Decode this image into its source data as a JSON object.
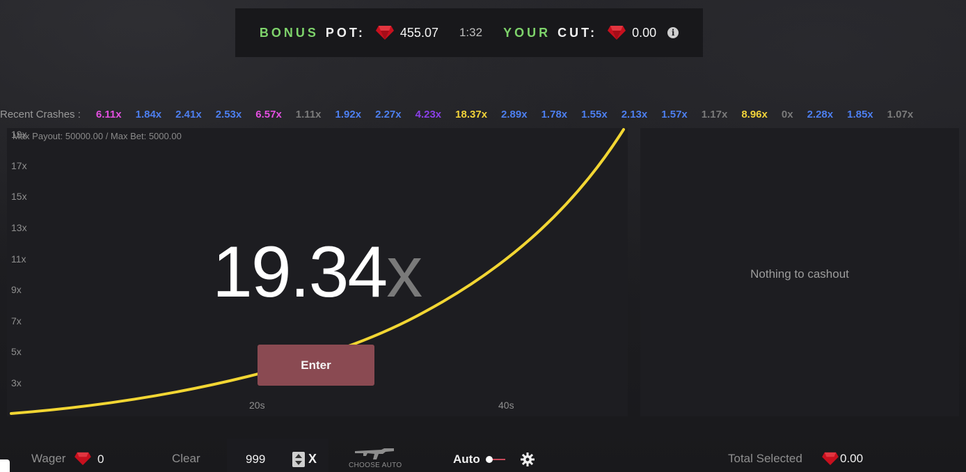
{
  "header": {
    "bonus_word": "BONUS",
    "pot_word": "POT:",
    "pot_value": "455.07",
    "timer": "1:32",
    "your_word": "YOUR",
    "cut_word": "CUT:",
    "cut_value": "0.00",
    "info_icon": "i"
  },
  "recent": {
    "label": "Recent Crashes :",
    "items": [
      {
        "text": "6.11x",
        "color": "#e34fe0"
      },
      {
        "text": "1.84x",
        "color": "#4d7ff0"
      },
      {
        "text": "2.41x",
        "color": "#4d7ff0"
      },
      {
        "text": "2.53x",
        "color": "#4d7ff0"
      },
      {
        "text": "6.57x",
        "color": "#e34fe0"
      },
      {
        "text": "1.11x",
        "color": "#7a7a7a"
      },
      {
        "text": "1.92x",
        "color": "#4d7ff0"
      },
      {
        "text": "2.27x",
        "color": "#4d7ff0"
      },
      {
        "text": "4.23x",
        "color": "#8a3fe8"
      },
      {
        "text": "18.37x",
        "color": "#f2d33a"
      },
      {
        "text": "2.89x",
        "color": "#4d7ff0"
      },
      {
        "text": "1.78x",
        "color": "#4d7ff0"
      },
      {
        "text": "1.55x",
        "color": "#4d7ff0"
      },
      {
        "text": "2.13x",
        "color": "#4d7ff0"
      },
      {
        "text": "1.57x",
        "color": "#4d7ff0"
      },
      {
        "text": "1.17x",
        "color": "#7a7a7a"
      },
      {
        "text": "8.96x",
        "color": "#f2d33a"
      },
      {
        "text": "0x",
        "color": "#7a7a7a"
      },
      {
        "text": "2.28x",
        "color": "#4d7ff0"
      },
      {
        "text": "1.85x",
        "color": "#4d7ff0"
      },
      {
        "text": "1.07x",
        "color": "#7a7a7a"
      }
    ]
  },
  "graph": {
    "max_payout": "Max Payout: 50000.00 / Max Bet: 5000.00",
    "y_ticks": [
      "19x",
      "17x",
      "15x",
      "13x",
      "11x",
      "9x",
      "7x",
      "5x",
      "3x"
    ],
    "x_ticks": [
      "20s",
      "40s"
    ],
    "multiplier_value": "19.34",
    "multiplier_suffix": "x",
    "curve_color": "#f2d633",
    "enter_label": "Enter"
  },
  "cashout": {
    "empty_text": "Nothing to cashout"
  },
  "footer": {
    "wager_label": "Wager",
    "wager_value": "0",
    "clear_label": "Clear",
    "count_value": "999",
    "x_label": "X",
    "choose_auto_label": "CHOOSE AUTO",
    "auto_label": "Auto",
    "total_label": "Total Selected",
    "total_value": "0.00"
  },
  "colors": {
    "gem": "#c8101e",
    "accent_green": "#7ed36b",
    "enter_button": "#8a4a52"
  }
}
